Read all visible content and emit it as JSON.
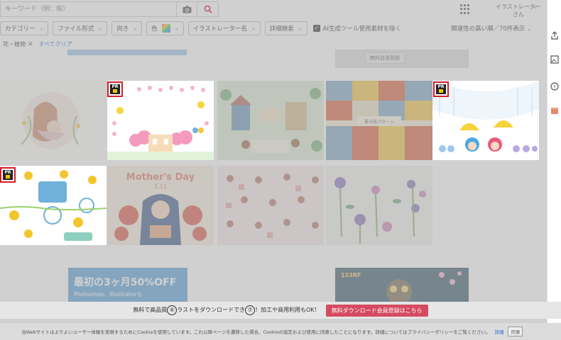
{
  "search": {
    "placeholder": "キーワード（例：桜）"
  },
  "header": {
    "user_label_line1": "イラストレーター",
    "user_label_line2": "さん"
  },
  "filters": [
    {
      "label": "カテゴリー"
    },
    {
      "label": "ファイル形式"
    },
    {
      "label": "向き"
    },
    {
      "label": "色"
    },
    {
      "label": "イラストレーター名"
    },
    {
      "label": "詳細検索"
    }
  ],
  "ai_filter": {
    "label": "AI生成ツール使用素材を除く",
    "checked": true
  },
  "sort": {
    "label": "関連性の高い順／70件表示"
  },
  "chips": {
    "active": "花・植物",
    "clear_all": "すべてクリア"
  },
  "top_banner": {
    "label": "無料会員登録"
  },
  "pr_badge": {
    "label": "PR"
  },
  "thumbnails": [
    {
      "name": "mother-and-child",
      "pr": false,
      "spot": false
    },
    {
      "name": "spring-frame-flowers",
      "pr": true,
      "spot": true
    },
    {
      "name": "town-animals",
      "pr": false,
      "spot": false
    },
    {
      "name": "flower-pattern",
      "pr": false,
      "spot": false,
      "caption": "夏の花パターン"
    },
    {
      "name": "rainy-kids",
      "pr": true,
      "spot": true
    },
    {
      "name": "yellow-flowers-set",
      "pr": true,
      "spot": true
    },
    {
      "name": "mothers-day",
      "pr": false,
      "spot": false,
      "caption": "Mother's Day",
      "sub": "5.11"
    },
    {
      "name": "pink-pattern",
      "pr": false,
      "spot": false
    },
    {
      "name": "purple-flowers",
      "pr": false,
      "spot": false
    }
  ],
  "bottom_banners": {
    "left_big": "最初の3ヶ月50%OFF",
    "left_small": "Photoshop、Illustratorも",
    "right_brand": "123RF"
  },
  "promo": {
    "text_a": "無料で高品質",
    "text_b": "ラストをダウンロードでき",
    "text_c": "！加工や商用利用もOK！",
    "button": "無料ダウンロード会員登録はこちら",
    "step6": "⑥",
    "step7": "⑦"
  },
  "cookie": {
    "text": "当Webサイトはよりよいユーザー体験を実現するためにCookieを使用しています。これ以降ページを遷移した場合、Cookieの設定および使用に同意したことになります。詳細についてはプライバシーポリシーをご覧ください。",
    "details": "詳細",
    "agree": "同意"
  },
  "colors": {
    "pr_border": "#d21f2b",
    "accent_red": "#d44b60",
    "link": "#2a6bd1"
  }
}
